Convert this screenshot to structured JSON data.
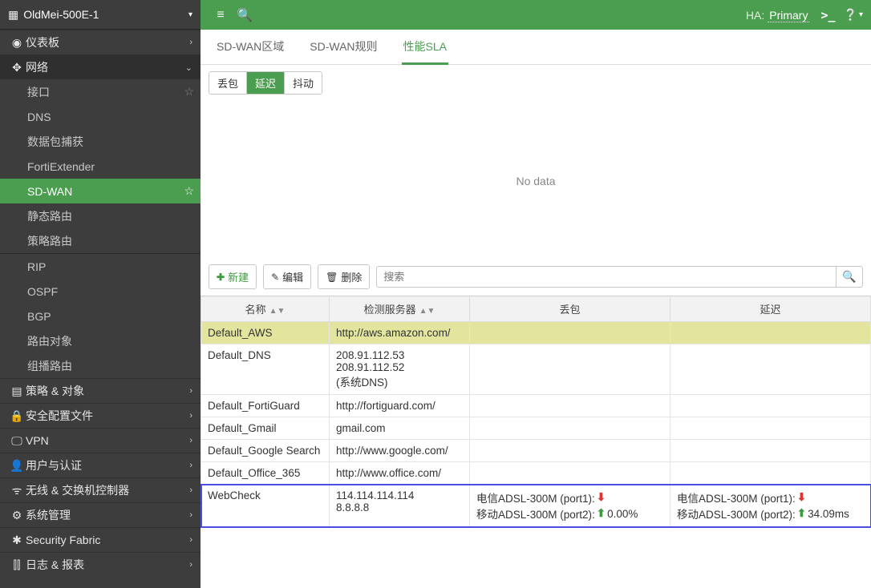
{
  "topbar": {
    "hostname": "OldMei-500E-1",
    "ha_label": "HA:",
    "ha_value": "Primary",
    "cli": ">_"
  },
  "sidebar": {
    "items": [
      {
        "icon": "◉",
        "label": "仪表板",
        "chev": "›"
      },
      {
        "icon": "✥",
        "label": "网络",
        "chev": "⌄",
        "expanded": true,
        "children": [
          {
            "label": "接口",
            "star": true
          },
          {
            "label": "DNS"
          },
          {
            "label": "数据包捕获"
          },
          {
            "label": "FortiExtender"
          },
          {
            "label": "SD-WAN",
            "active": true,
            "star": true
          },
          {
            "label": "静态路由"
          },
          {
            "label": "策略路由"
          },
          {
            "divider": true
          },
          {
            "label": "RIP"
          },
          {
            "label": "OSPF"
          },
          {
            "label": "BGP"
          },
          {
            "label": "路由对象"
          },
          {
            "label": "组播路由"
          }
        ]
      },
      {
        "icon": "▤",
        "label": "策略 & 对象",
        "chev": "›"
      },
      {
        "icon": "🔒",
        "label": "安全配置文件",
        "chev": "›"
      },
      {
        "icon": "🖵",
        "label": "VPN",
        "chev": "›"
      },
      {
        "icon": "👤",
        "label": "用户与认证",
        "chev": "›"
      },
      {
        "icon": "ᯤ",
        "label": "无线 & 交换机控制器",
        "chev": "›"
      },
      {
        "icon": "⚙",
        "label": "系统管理",
        "chev": "›"
      },
      {
        "icon": "✱",
        "label": "Security Fabric",
        "chev": "›"
      },
      {
        "icon": "⫿⫿",
        "label": "日志 & 报表",
        "chev": "›"
      }
    ]
  },
  "tabs": {
    "items": [
      {
        "label": "SD-WAN区域"
      },
      {
        "label": "SD-WAN规则"
      },
      {
        "label": "性能SLA",
        "active": true
      }
    ]
  },
  "metrics": [
    {
      "label": "丢包"
    },
    {
      "label": "延迟",
      "active": true
    },
    {
      "label": "抖动"
    }
  ],
  "chart": {
    "empty_text": "No data"
  },
  "toolbar": {
    "create": "新建",
    "edit": "编辑",
    "delete": "删除",
    "search_placeholder": "搜索"
  },
  "table": {
    "columns": [
      {
        "label": "名称",
        "sort": true
      },
      {
        "label": "检测服务器",
        "sort": true
      },
      {
        "label": "丢包"
      },
      {
        "label": "延迟"
      }
    ],
    "rows": [
      {
        "selected": true,
        "name": "Default_AWS",
        "server": "http://aws.amazon.com/",
        "loss": "",
        "latency": ""
      },
      {
        "name": "Default_DNS",
        "server": "208.91.112.53\n208.91.112.52\n(系统DNS)",
        "loss": "",
        "latency": ""
      },
      {
        "name": "Default_FortiGuard",
        "server": "http://fortiguard.com/",
        "loss": "",
        "latency": ""
      },
      {
        "name": "Default_Gmail",
        "server": "gmail.com",
        "loss": "",
        "latency": ""
      },
      {
        "name": "Default_Google Search",
        "server": "http://www.google.com/",
        "loss": "",
        "latency": ""
      },
      {
        "name": "Default_Office_365",
        "server": "http://www.office.com/",
        "loss": "",
        "latency": ""
      },
      {
        "highlight": true,
        "name": "WebCheck",
        "server": "114.114.114.114\n8.8.8.8",
        "loss_lines": [
          {
            "text": "电信ADSL-300M (port1):",
            "dir": "down",
            "val": ""
          },
          {
            "text": "移动ADSL-300M (port2):",
            "dir": "up",
            "val": "0.00%"
          }
        ],
        "latency_lines": [
          {
            "text": "电信ADSL-300M (port1):",
            "dir": "down",
            "val": ""
          },
          {
            "text": "移动ADSL-300M (port2):",
            "dir": "up",
            "val": "34.09ms"
          }
        ]
      }
    ]
  }
}
